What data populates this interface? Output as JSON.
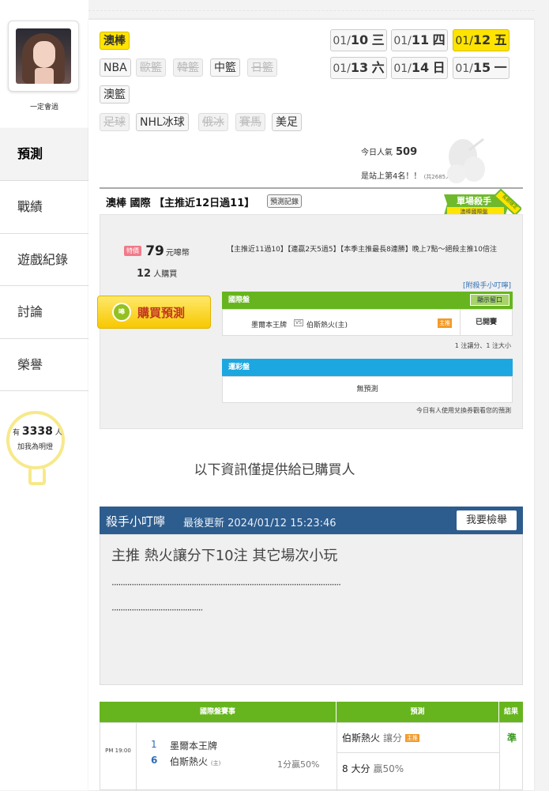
{
  "sidebar": {
    "nickname": "一定會過",
    "items": [
      {
        "label": "預測"
      },
      {
        "label": "戰績"
      },
      {
        "label": "遊戲紀錄"
      },
      {
        "label": "討論"
      },
      {
        "label": "榮譽"
      }
    ],
    "fans": {
      "prefix": "有",
      "count": "3338",
      "suffix": "人",
      "caption": "加我為明燈"
    }
  },
  "categories": {
    "row1": [
      "澳棒"
    ],
    "row2": [
      "NBA",
      "歐籃",
      "韓籃",
      "中籃",
      "日籃"
    ],
    "row3": [
      "澳籃"
    ],
    "row4": [
      "足球",
      "NHL冰球",
      "俄冰",
      "賽馬",
      "美足"
    ],
    "active": "澳棒",
    "disabled": [
      "歐籃",
      "韓籃",
      "日籃",
      "足球",
      "俄冰",
      "賽馬"
    ]
  },
  "dates": [
    {
      "md": "01/",
      "day": "10",
      "wd": "三",
      "active": false
    },
    {
      "md": "01/",
      "day": "11",
      "wd": "四",
      "active": false
    },
    {
      "md": "01/",
      "day": "12",
      "wd": "五",
      "active": true
    },
    {
      "md": "01/",
      "day": "13",
      "wd": "六",
      "active": false
    },
    {
      "md": "01/",
      "day": "14",
      "wd": "日",
      "active": false
    },
    {
      "md": "01/",
      "day": "15",
      "wd": "一",
      "active": false
    }
  ],
  "popularity": {
    "label": "今日人氣",
    "value": "509",
    "rank_text": "是站上第4名！！",
    "rank_total": "(共2685人)"
  },
  "badge": {
    "title": "單場殺手",
    "sub": "澳棒國際盤",
    "ribbon": "長期穩定"
  },
  "pick": {
    "title": "澳棒 國際 【主推近12日過11】",
    "record_button": "預測記錄",
    "price_tag": "特價",
    "price": "79",
    "price_unit": "元嗥幣",
    "buyers": "12",
    "buyers_unit": "人購買",
    "buy_button": "購買預測",
    "coin_label": "嗥",
    "description": "【主推近11過10】【連贏2天5過5】【本季主推最長8連勝】晚上7點～絕殺主推10倍注",
    "tip_link": "[附殺手小叮嚀]",
    "intl_header": "國際盤",
    "show_button": "顯示留口",
    "home_team": "墨爾本王牌",
    "vs": "VS",
    "away_team": "伯斯熱火(主)",
    "marker": "主推",
    "status": "已開賽",
    "units": "1 注讓分、1 注大小",
    "lottery_header": "運彩盤",
    "lottery_value": "無預測",
    "ticket_note": "今日有人使用兌換券觀看您的預測"
  },
  "info_text": "以下資訊僅提供給已購買人",
  "tip": {
    "title": "殺手小叮嚀",
    "updated": "最後更新 2024/01/12 15:23:46",
    "report_button": "我要檢舉",
    "content": "主推 熱火讓分下10注 其它場次小玩",
    "dots1": "·······································································································",
    "dots2": "·········································"
  },
  "table": {
    "headers": [
      "國際盤賽事",
      "預測",
      "結果"
    ],
    "time": "PM 19:00",
    "n1": "1",
    "team1": "墨爾本王牌",
    "n2": "6",
    "team2": "伯斯熱火",
    "team2_tag": "(主)",
    "handicap": "1分贏50%",
    "pred1_team": "伯斯熱火",
    "pred1_type": "讓分",
    "pred1_marker": "主推",
    "pred2": "8 大分",
    "pred2_rate": "贏50%",
    "result": "準"
  }
}
